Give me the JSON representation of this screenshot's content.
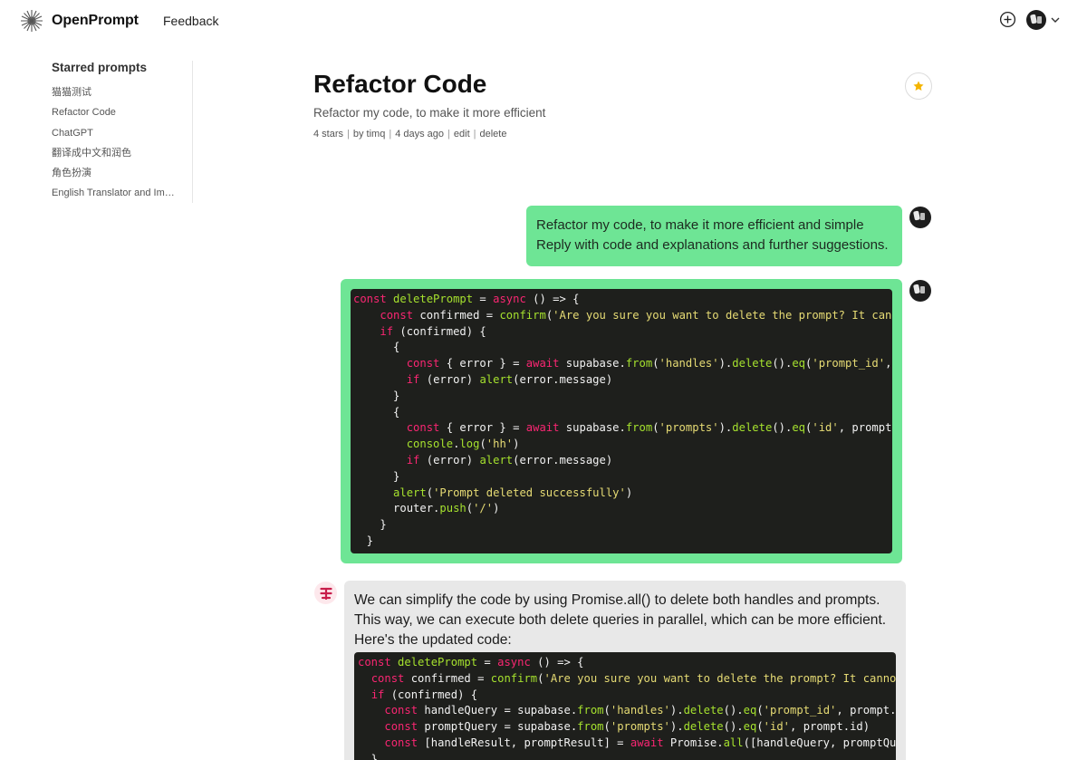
{
  "app": {
    "name": "OpenPrompt"
  },
  "nav": {
    "feedback": "Feedback"
  },
  "sidebar": {
    "title": "Starred prompts",
    "items": [
      {
        "label": "猫猫测试"
      },
      {
        "label": "Refactor Code"
      },
      {
        "label": "ChatGPT"
      },
      {
        "label": "翻译成中文和润色"
      },
      {
        "label": "角色扮演"
      },
      {
        "label": "English Translator and Improver"
      }
    ]
  },
  "prompt": {
    "title": "Refactor Code",
    "description": "Refactor my code, to make it more efficient",
    "stars": "4 stars",
    "author": "by timq",
    "age": "4 days ago",
    "edit": "edit",
    "delete": "delete"
  },
  "messages": {
    "user_prompt_line1": "Refactor my code, to make it more efficient and simple",
    "user_prompt_line2": "Reply with code and explanations and further suggestions.",
    "user_code_lines": [
      [
        [
          "kw",
          "const "
        ],
        [
          "fn",
          "deletePrompt"
        ],
        [
          "pl",
          " = "
        ],
        [
          "kw",
          "async"
        ],
        [
          "pl",
          " () => {"
        ]
      ],
      [
        [
          "pl",
          "    "
        ],
        [
          "kw",
          "const "
        ],
        [
          "pl",
          "confirmed = "
        ],
        [
          "fn",
          "confirm"
        ],
        [
          "pl",
          "("
        ],
        [
          "str",
          "'Are you sure you want to delete the prompt? It can not be undone.'"
        ],
        [
          "pl",
          ")"
        ]
      ],
      [
        [
          "pl",
          "    "
        ],
        [
          "kw",
          "if"
        ],
        [
          "pl",
          " (confirmed) {"
        ]
      ],
      [
        [
          "pl",
          "      {"
        ]
      ],
      [
        [
          "pl",
          "        "
        ],
        [
          "kw",
          "const"
        ],
        [
          "pl",
          " { error } = "
        ],
        [
          "kw",
          "await"
        ],
        [
          "pl",
          " supabase."
        ],
        [
          "fn",
          "from"
        ],
        [
          "pl",
          "("
        ],
        [
          "str",
          "'handles'"
        ],
        [
          "pl",
          ")."
        ],
        [
          "fn",
          "delete"
        ],
        [
          "pl",
          "()."
        ],
        [
          "fn",
          "eq"
        ],
        [
          "pl",
          "("
        ],
        [
          "str",
          "'prompt_id'"
        ],
        [
          "pl",
          ", prompt.id)"
        ]
      ],
      [
        [
          "pl",
          "        "
        ],
        [
          "kw",
          "if"
        ],
        [
          "pl",
          " (error) "
        ],
        [
          "fn",
          "alert"
        ],
        [
          "pl",
          "(error.message)"
        ]
      ],
      [
        [
          "pl",
          "      }"
        ]
      ],
      [
        [
          "pl",
          "      {"
        ]
      ],
      [
        [
          "pl",
          "        "
        ],
        [
          "kw",
          "const"
        ],
        [
          "pl",
          " { error } = "
        ],
        [
          "kw",
          "await"
        ],
        [
          "pl",
          " supabase."
        ],
        [
          "fn",
          "from"
        ],
        [
          "pl",
          "("
        ],
        [
          "str",
          "'prompts'"
        ],
        [
          "pl",
          ")."
        ],
        [
          "fn",
          "delete"
        ],
        [
          "pl",
          "()."
        ],
        [
          "fn",
          "eq"
        ],
        [
          "pl",
          "("
        ],
        [
          "str",
          "'id'"
        ],
        [
          "pl",
          ", prompt.id)"
        ]
      ],
      [
        [
          "pl",
          "        "
        ],
        [
          "fn",
          "console"
        ],
        [
          "pl",
          "."
        ],
        [
          "fn",
          "log"
        ],
        [
          "pl",
          "("
        ],
        [
          "str",
          "'hh'"
        ],
        [
          "pl",
          ")"
        ]
      ],
      [
        [
          "pl",
          "        "
        ],
        [
          "kw",
          "if"
        ],
        [
          "pl",
          " (error) "
        ],
        [
          "fn",
          "alert"
        ],
        [
          "pl",
          "(error.message)"
        ]
      ],
      [
        [
          "pl",
          "      }"
        ]
      ],
      [
        [
          "pl",
          "      "
        ],
        [
          "fn",
          "alert"
        ],
        [
          "pl",
          "("
        ],
        [
          "str",
          "'Prompt deleted successfully'"
        ],
        [
          "pl",
          ")"
        ]
      ],
      [
        [
          "pl",
          "      router."
        ],
        [
          "fn",
          "push"
        ],
        [
          "pl",
          "("
        ],
        [
          "str",
          "'/'"
        ],
        [
          "pl",
          ")"
        ]
      ],
      [
        [
          "pl",
          "    }"
        ]
      ],
      [
        [
          "pl",
          "  }"
        ]
      ]
    ],
    "ai_text": "We can simplify the code by using Promise.all() to delete both handles and prompts. This way, we can execute both delete queries in parallel, which can be more efficient. Here's the updated code:",
    "ai_code_lines": [
      [
        [
          "kw",
          "const "
        ],
        [
          "fn",
          "deletePrompt"
        ],
        [
          "pl",
          " = "
        ],
        [
          "kw",
          "async"
        ],
        [
          "pl",
          " () => {"
        ]
      ],
      [
        [
          "pl",
          "  "
        ],
        [
          "kw",
          "const "
        ],
        [
          "pl",
          "confirmed = "
        ],
        [
          "fn",
          "confirm"
        ],
        [
          "pl",
          "("
        ],
        [
          "str",
          "'Are you sure you want to delete the prompt? It cannot be undone.'"
        ],
        [
          "pl",
          ")"
        ]
      ],
      [
        [
          "pl",
          "  "
        ],
        [
          "kw",
          "if"
        ],
        [
          "pl",
          " (confirmed) {"
        ]
      ],
      [
        [
          "pl",
          "    "
        ],
        [
          "kw",
          "const "
        ],
        [
          "pl",
          "handleQuery = supabase."
        ],
        [
          "fn",
          "from"
        ],
        [
          "pl",
          "("
        ],
        [
          "str",
          "'handles'"
        ],
        [
          "pl",
          ")."
        ],
        [
          "fn",
          "delete"
        ],
        [
          "pl",
          "()."
        ],
        [
          "fn",
          "eq"
        ],
        [
          "pl",
          "("
        ],
        [
          "str",
          "'prompt_id'"
        ],
        [
          "pl",
          ", prompt.id)"
        ]
      ],
      [
        [
          "pl",
          "    "
        ],
        [
          "kw",
          "const "
        ],
        [
          "pl",
          "promptQuery = supabase."
        ],
        [
          "fn",
          "from"
        ],
        [
          "pl",
          "("
        ],
        [
          "str",
          "'prompts'"
        ],
        [
          "pl",
          ")."
        ],
        [
          "fn",
          "delete"
        ],
        [
          "pl",
          "()."
        ],
        [
          "fn",
          "eq"
        ],
        [
          "pl",
          "("
        ],
        [
          "str",
          "'id'"
        ],
        [
          "pl",
          ", prompt.id)"
        ]
      ],
      [
        [
          "pl",
          "    "
        ],
        [
          "kw",
          "const "
        ],
        [
          "pl",
          "[handleResult, promptResult] = "
        ],
        [
          "kw",
          "await"
        ],
        [
          "pl",
          " Promise."
        ],
        [
          "fn",
          "all"
        ],
        [
          "pl",
          "([handleQuery, promptQuery])"
        ]
      ],
      [
        [
          "pl",
          "  }"
        ]
      ]
    ]
  },
  "icons": {
    "logo": "openprompt-logo-icon",
    "add": "plus-circle-icon",
    "chevron": "chevron-down-icon",
    "star": "star-icon",
    "ai": "assistant-logo-icon"
  },
  "colors": {
    "user_bubble": "#6ee595",
    "ai_bubble": "#e8e8e8",
    "code_bg": "#1e1f1c",
    "star": "#f4b400",
    "keyword": "#f92672",
    "function": "#a6e22e",
    "string": "#e6db74"
  }
}
